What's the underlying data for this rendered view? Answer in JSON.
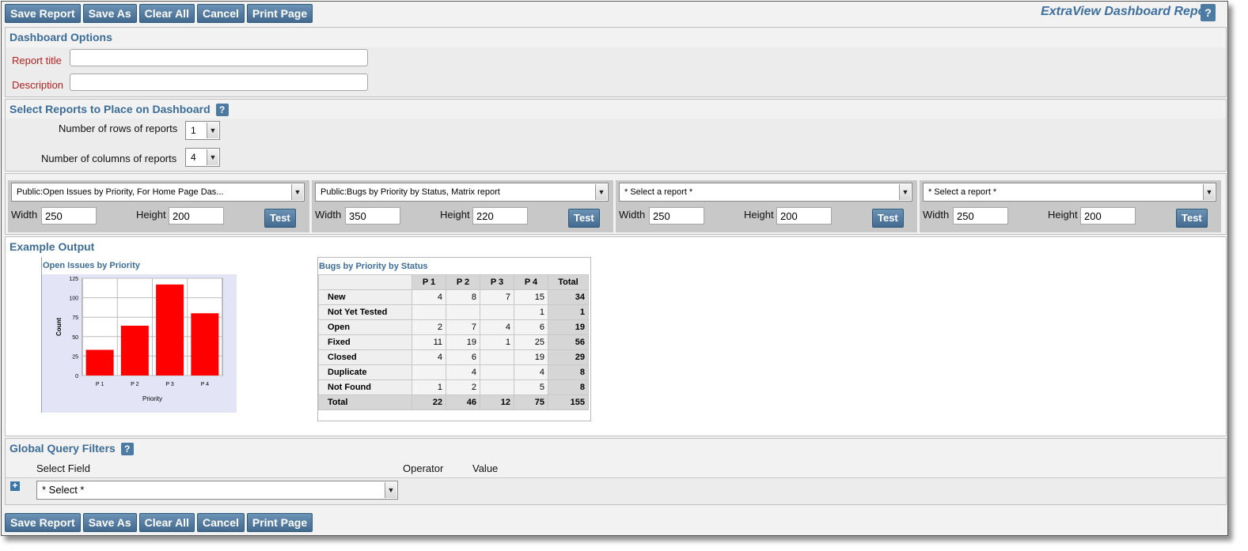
{
  "toolbar": {
    "buttons": [
      "Save Report",
      "Save As",
      "Clear All",
      "Cancel",
      "Print Page"
    ]
  },
  "app_title": "ExtraView Dashboard Report",
  "help_label": "?",
  "dashboard_options": {
    "title": "Dashboard Options",
    "report_title_label": "Report title",
    "report_title_value": "",
    "description_label": "Description",
    "description_value": ""
  },
  "select_reports": {
    "title": "Select Reports to Place on Dashboard",
    "rows_label": "Number of rows of reports",
    "rows_value": "1",
    "cols_label": "Number of columns of reports",
    "cols_value": "4"
  },
  "report_slots": [
    {
      "report": "Public:Open Issues by Priority, For Home Page Das...",
      "width_label": "Width",
      "width": "250",
      "height_label": "Height",
      "height": "200",
      "test_label": "Test"
    },
    {
      "report": "Public:Bugs by Priority by Status, Matrix report",
      "width_label": "Width",
      "width": "350",
      "height_label": "Height",
      "height": "220",
      "test_label": "Test"
    },
    {
      "report": "* Select a report *",
      "width_label": "Width",
      "width": "250",
      "height_label": "Height",
      "height": "200",
      "test_label": "Test"
    },
    {
      "report": "* Select a report *",
      "width_label": "Width",
      "width": "250",
      "height_label": "Height",
      "height": "200",
      "test_label": "Test"
    }
  ],
  "example_output": {
    "title": "Example Output"
  },
  "chart_data": [
    {
      "type": "bar",
      "title": "Open Issues by Priority",
      "xlabel": "Priority",
      "ylabel": "Count",
      "categories": [
        "P 1",
        "P 2",
        "P 3",
        "P 4"
      ],
      "values": [
        33,
        64,
        117,
        80
      ],
      "ylim": [
        0,
        125
      ],
      "yticks": [
        "0",
        "25",
        "50",
        "75",
        "100",
        "125"
      ],
      "bar_color": "#ff0000",
      "grid": true
    },
    {
      "type": "table",
      "title": "Bugs by Priority by Status",
      "columns": [
        "P 1",
        "P 2",
        "P 3",
        "P 4",
        "Total"
      ],
      "rows": [
        {
          "label": "New",
          "cells": [
            "4",
            "8",
            "7",
            "15",
            "34"
          ]
        },
        {
          "label": "Not Yet Tested",
          "cells": [
            "",
            "",
            "",
            "1",
            "1"
          ]
        },
        {
          "label": "Open",
          "cells": [
            "2",
            "7",
            "4",
            "6",
            "19"
          ]
        },
        {
          "label": "Fixed",
          "cells": [
            "11",
            "19",
            "1",
            "25",
            "56"
          ]
        },
        {
          "label": "Closed",
          "cells": [
            "4",
            "6",
            "",
            "19",
            "29"
          ]
        },
        {
          "label": "Duplicate",
          "cells": [
            "",
            "4",
            "",
            "4",
            "8"
          ]
        },
        {
          "label": "Not Found",
          "cells": [
            "1",
            "2",
            "",
            "5",
            "8"
          ]
        },
        {
          "label": "Total",
          "cells": [
            "22",
            "46",
            "12",
            "75",
            "155"
          ]
        }
      ]
    }
  ],
  "global_filters": {
    "title": "Global Query Filters",
    "select_field_label": "Select Field",
    "operator_label": "Operator",
    "value_label": "Value",
    "field_select_value": "* Select *",
    "add_icon": "+"
  }
}
